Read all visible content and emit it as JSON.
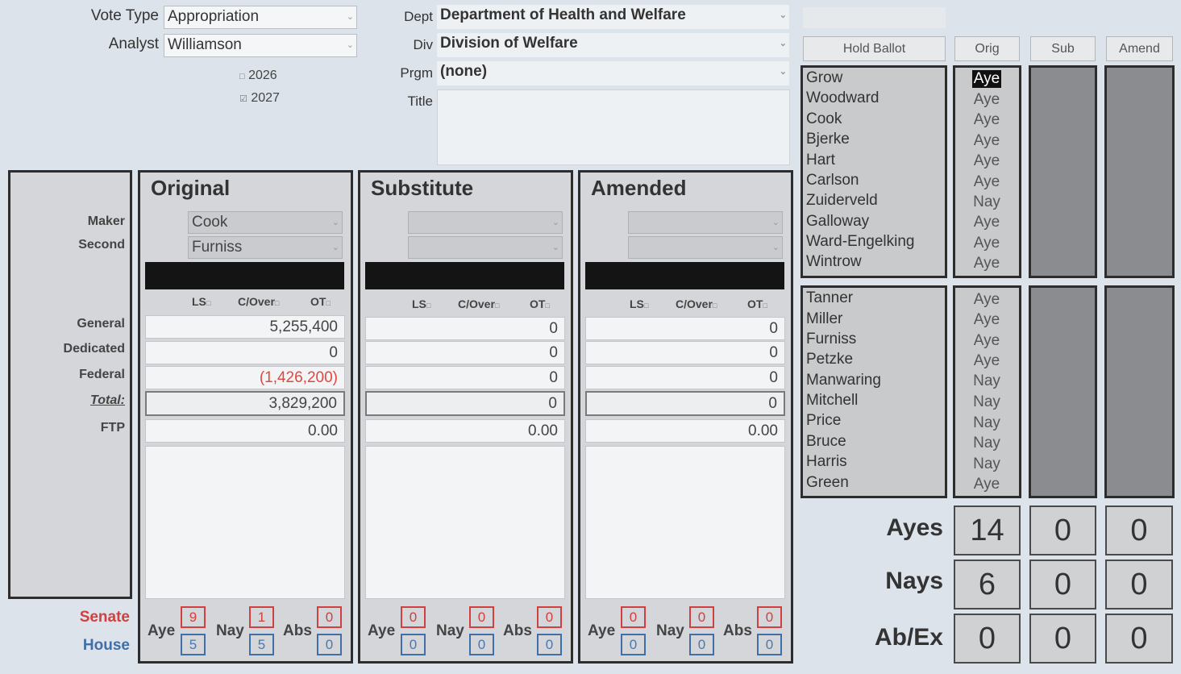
{
  "header": {
    "vote_type_label": "Vote Type",
    "vote_type_value": "Appropriation",
    "analyst_label": "Analyst",
    "analyst_value": "Williamson",
    "year_1": "2026",
    "year_2": "2027",
    "year_1_box": "□",
    "year_2_box": "☑",
    "dept_label": "Dept",
    "dept_value": "Department of Health and Welfare",
    "div_label": "Div",
    "div_value": "Division of Welfare",
    "prgm_label": "Prgm",
    "prgm_value": "(none)",
    "title_label": "Title",
    "title_value": ""
  },
  "row_labels": {
    "maker": "Maker",
    "second": "Second",
    "general": "General",
    "dedicated": "Dedicated",
    "federal": "Federal",
    "total": "Total:",
    "ftp": "FTP",
    "senate": "Senate",
    "house": "House"
  },
  "flags": {
    "ls": "LS",
    "cover": "C/Over",
    "ot": "OT"
  },
  "vote_labels": {
    "aye": "Aye",
    "nay": "Nay",
    "abs": "Abs"
  },
  "panels": [
    {
      "title": "Original",
      "maker": "Cook",
      "second": "Furniss",
      "general": "5,255,400",
      "dedicated": "0",
      "federal": "(1,426,200)",
      "total": "3,829,200",
      "ftp": "0.00",
      "senate_aye": "9",
      "senate_nay": "1",
      "senate_abs": "0",
      "house_aye": "5",
      "house_nay": "5",
      "house_abs": "0"
    },
    {
      "title": "Substitute",
      "maker": "",
      "second": "",
      "general": "0",
      "dedicated": "0",
      "federal": "0",
      "total": "0",
      "ftp": "0.00",
      "senate_aye": "0",
      "senate_nay": "0",
      "senate_abs": "0",
      "house_aye": "0",
      "house_nay": "0",
      "house_abs": "0"
    },
    {
      "title": "Amended",
      "maker": "",
      "second": "",
      "general": "0",
      "dedicated": "0",
      "federal": "0",
      "total": "0",
      "ftp": "0.00",
      "senate_aye": "0",
      "senate_nay": "0",
      "senate_abs": "0",
      "house_aye": "0",
      "house_nay": "0",
      "house_abs": "0"
    }
  ],
  "ballot": {
    "hold_ballot_label": "Hold Ballot",
    "col_orig": "Orig",
    "col_sub": "Sub",
    "col_amend": "Amend",
    "senate": [
      {
        "name": "Grow",
        "vote": "Aye"
      },
      {
        "name": "Woodward",
        "vote": "Aye"
      },
      {
        "name": "Cook",
        "vote": "Aye"
      },
      {
        "name": "Bjerke",
        "vote": "Aye"
      },
      {
        "name": "Hart",
        "vote": "Aye"
      },
      {
        "name": "Carlson",
        "vote": "Aye"
      },
      {
        "name": "Zuiderveld",
        "vote": "Nay"
      },
      {
        "name": "Galloway",
        "vote": "Aye"
      },
      {
        "name": "Ward-Engelking",
        "vote": "Aye"
      },
      {
        "name": "Wintrow",
        "vote": "Aye"
      }
    ],
    "house": [
      {
        "name": "Tanner",
        "vote": "Aye"
      },
      {
        "name": "Miller",
        "vote": "Aye"
      },
      {
        "name": "Furniss",
        "vote": "Aye"
      },
      {
        "name": "Petzke",
        "vote": "Aye"
      },
      {
        "name": "Manwaring",
        "vote": "Nay"
      },
      {
        "name": "Mitchell",
        "vote": "Nay"
      },
      {
        "name": "Price",
        "vote": "Nay"
      },
      {
        "name": "Bruce",
        "vote": "Nay"
      },
      {
        "name": "Harris",
        "vote": "Nay"
      },
      {
        "name": "Green",
        "vote": "Aye"
      }
    ]
  },
  "totals": {
    "ayes_label": "Ayes",
    "nays_label": "Nays",
    "abex_label": "Ab/Ex",
    "orig": {
      "ayes": "14",
      "nays": "6",
      "abex": "0"
    },
    "sub": {
      "ayes": "0",
      "nays": "0",
      "abex": "0"
    },
    "amend": {
      "ayes": "0",
      "nays": "0",
      "abex": "0"
    }
  },
  "colors": {
    "senate": "#d04040",
    "house": "#3f6ea8",
    "negative": "#e0483f"
  }
}
